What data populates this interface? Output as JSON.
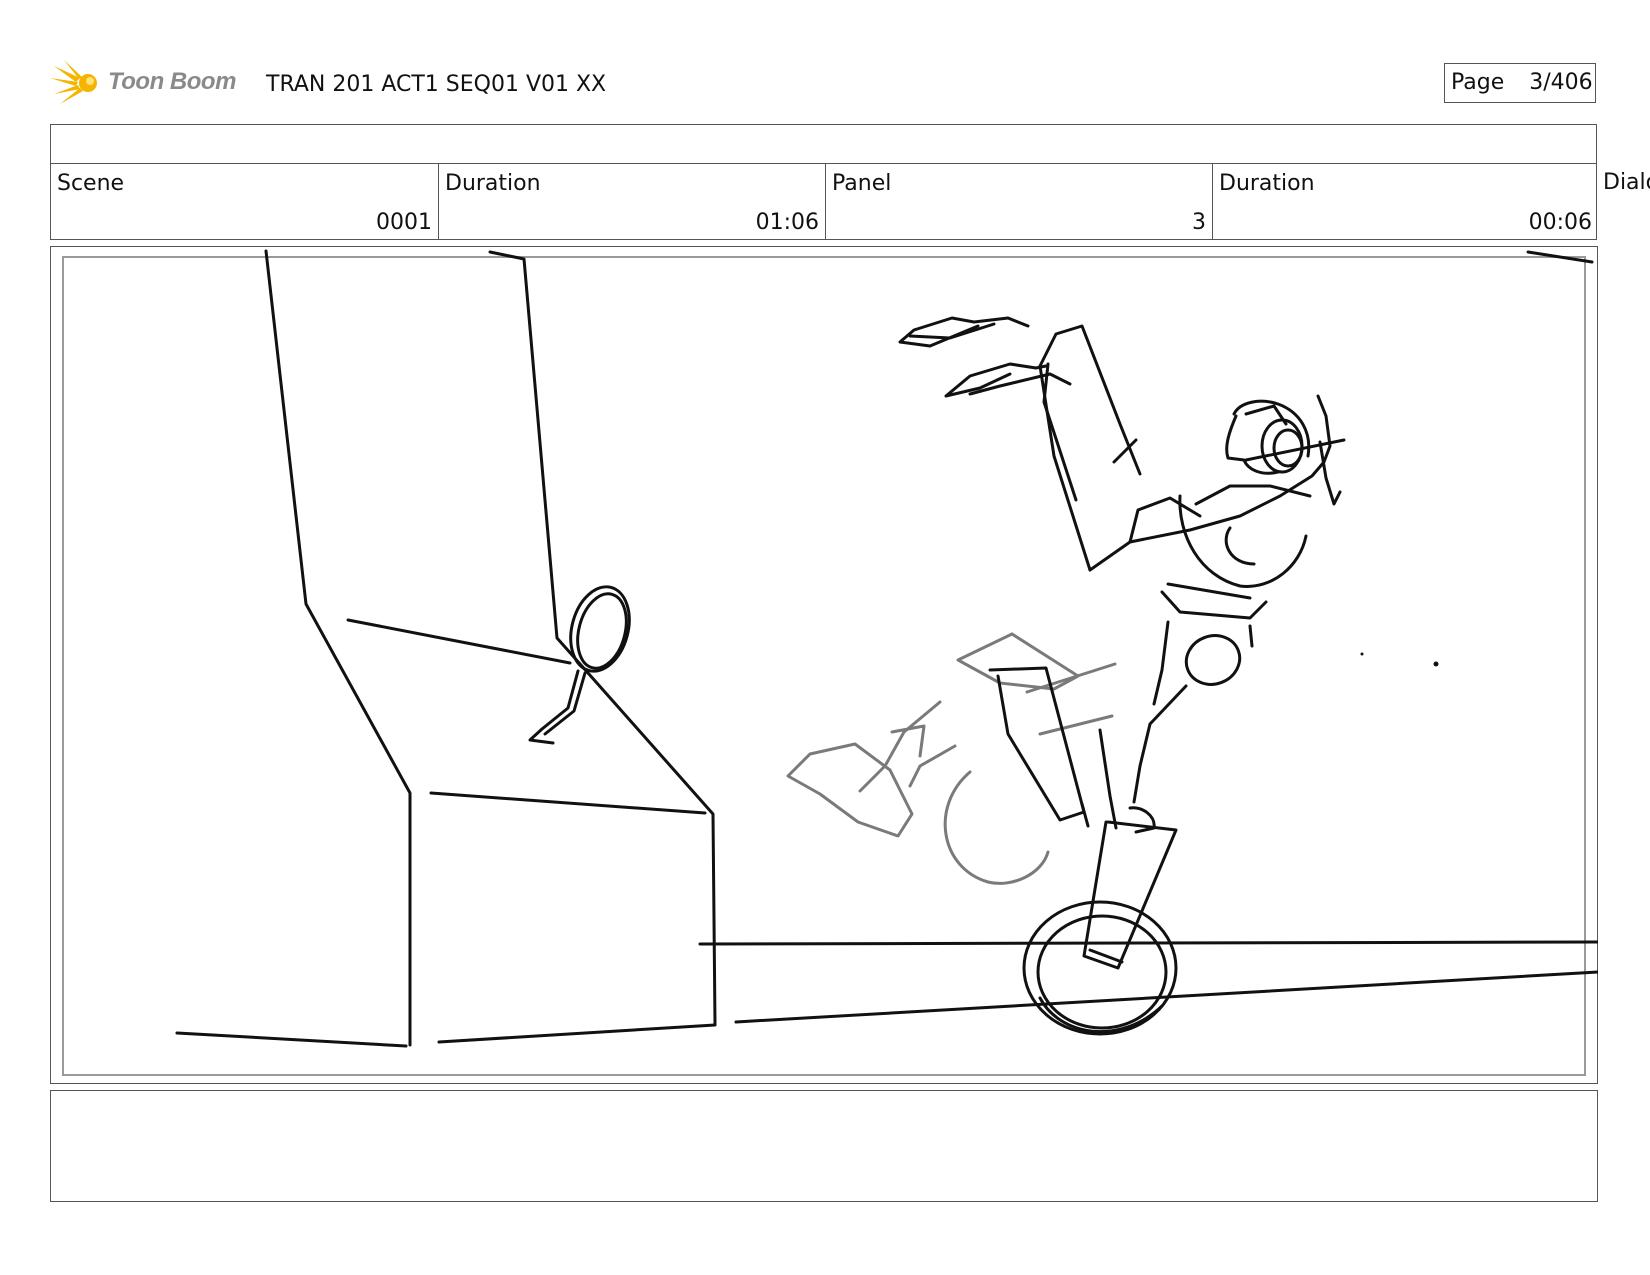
{
  "header": {
    "logo_text": "Toon Boom",
    "title": "TRAN 201 ACT1 SEQ01 V01 XX",
    "page_label": "Page",
    "page_value": "3/406"
  },
  "info": {
    "scene_label": "Scene",
    "scene_value": "0001",
    "duration_label": "Duration",
    "duration_value": "01:06",
    "panel_label": "Panel",
    "panel_value": "3",
    "panel_duration_label": "Duration",
    "panel_duration_value": "00:06",
    "dialogue_label": "Dialo"
  },
  "colors": {
    "logo_star": "#f5b400",
    "logo_text": "#8a8a8a",
    "border": "#555555",
    "sketch_dark": "#111111",
    "sketch_gray": "#7a7a7a"
  }
}
